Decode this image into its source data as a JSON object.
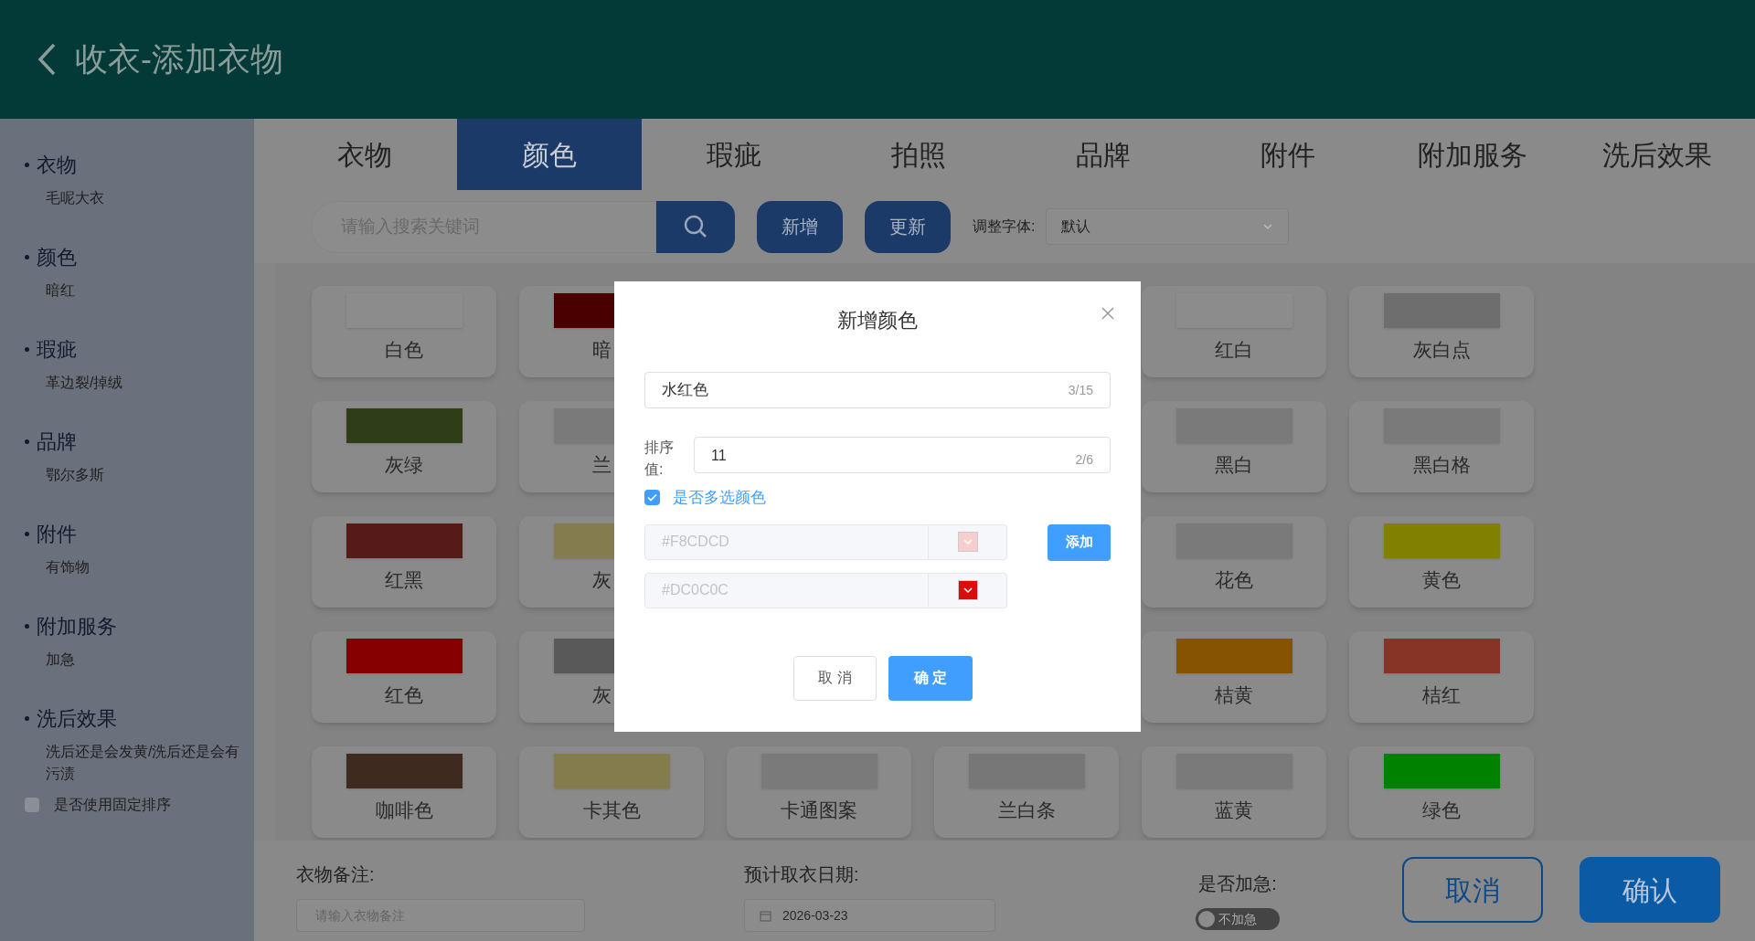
{
  "header": {
    "title": "收衣-添加衣物"
  },
  "sidebar": {
    "sections": [
      {
        "title": "衣物",
        "value": "毛呢大衣"
      },
      {
        "title": "颜色",
        "value": "暗红"
      },
      {
        "title": "瑕疵",
        "value": "革边裂/掉绒"
      },
      {
        "title": "品牌",
        "value": "鄂尔多斯"
      },
      {
        "title": "附件",
        "value": "有饰物"
      },
      {
        "title": "附加服务",
        "value": "加急"
      },
      {
        "title": "洗后效果",
        "value": "洗后还是会发黄/洗后还是会有污渍"
      }
    ],
    "fixed_order": {
      "label": "是否使用固定排序",
      "checked": false
    }
  },
  "tabs": [
    {
      "label": "衣物",
      "selected": false
    },
    {
      "label": "颜色",
      "selected": true
    },
    {
      "label": "瑕疵",
      "selected": false
    },
    {
      "label": "拍照",
      "selected": false
    },
    {
      "label": "品牌",
      "selected": false
    },
    {
      "label": "附件",
      "selected": false
    },
    {
      "label": "附加服务",
      "selected": false
    },
    {
      "label": "洗后效果",
      "selected": false
    }
  ],
  "toolbar": {
    "search_placeholder": "请输入搜索关键词",
    "buttons": [
      "新增",
      "更新"
    ],
    "font_label": "调整字体:",
    "font_value": "默认"
  },
  "color_rows": [
    [
      {
        "label": "白色",
        "color": "#8c8c8c",
        "kind": "full"
      },
      {
        "label": "暗",
        "color": "#4a0000",
        "kind": "cut"
      },
      {
        "label": "红白",
        "color": "#8c8c8c",
        "kind": "full"
      },
      {
        "label": "灰白点",
        "color": "#6e6e6e",
        "kind": "full"
      }
    ],
    [
      {
        "label": "灰绿",
        "color": "#2f3d18",
        "kind": "full"
      },
      {
        "label": "兰",
        "color": "#7a7a7a",
        "kind": "cut"
      },
      {
        "label": "黑白",
        "color": "#7a7a7a",
        "kind": "full"
      },
      {
        "label": "黑白格",
        "color": "#7a7a7a",
        "kind": "full"
      }
    ],
    [
      {
        "label": "红黑",
        "color": "#561a18",
        "kind": "full"
      },
      {
        "label": "灰",
        "color": "#847c4e",
        "kind": "cut"
      },
      {
        "label": "花色",
        "color": "#7a7a7a",
        "kind": "full"
      },
      {
        "label": "黄色",
        "color": "#828000",
        "kind": "full"
      }
    ],
    [
      {
        "label": "红色",
        "color": "#870000",
        "kind": "full"
      },
      {
        "label": "灰",
        "color": "#595959",
        "kind": "cut"
      },
      {
        "label": "桔黄",
        "color": "#845400",
        "kind": "full"
      },
      {
        "label": "桔红",
        "color": "#873426",
        "kind": "full"
      }
    ],
    [
      {
        "label": "咖啡色",
        "color": "#3e2a1e",
        "kind": "full"
      },
      {
        "label": "卡其色",
        "color": "#857c4e",
        "kind": "full"
      },
      {
        "label": "卡通图案",
        "color": "#7a7a7a",
        "kind": "full"
      },
      {
        "label": "兰白条",
        "color": "#777777",
        "kind": "full"
      },
      {
        "label": "蓝黄",
        "color": "#7a7a7a",
        "kind": "full"
      },
      {
        "label": "绿色",
        "color": "#008200",
        "kind": "full"
      }
    ]
  ],
  "footer": {
    "note_label": "衣物备注:",
    "note_placeholder": "请输入衣物备注",
    "date_label": "预计取衣日期:",
    "date_value": "2026-03-23",
    "urgent_label": "是否加急:",
    "urgent_switch": {
      "label": "不加急",
      "on": false
    },
    "cancel": "取消",
    "confirm": "确认"
  },
  "dialog": {
    "title": "新增颜色",
    "name": {
      "value": "水红色",
      "count": "3/15"
    },
    "sort": {
      "label": "排序值:",
      "value": "11",
      "count": "2/6"
    },
    "multi": {
      "label": "是否多选颜色",
      "checked": true
    },
    "colors": [
      {
        "value": "#F8CDCD",
        "color": "#f8cdcd"
      },
      {
        "value": "#DC0C0C",
        "color": "#dc0c0c"
      }
    ],
    "add": "添加",
    "cancel": "取 消",
    "ok": "确 定"
  }
}
